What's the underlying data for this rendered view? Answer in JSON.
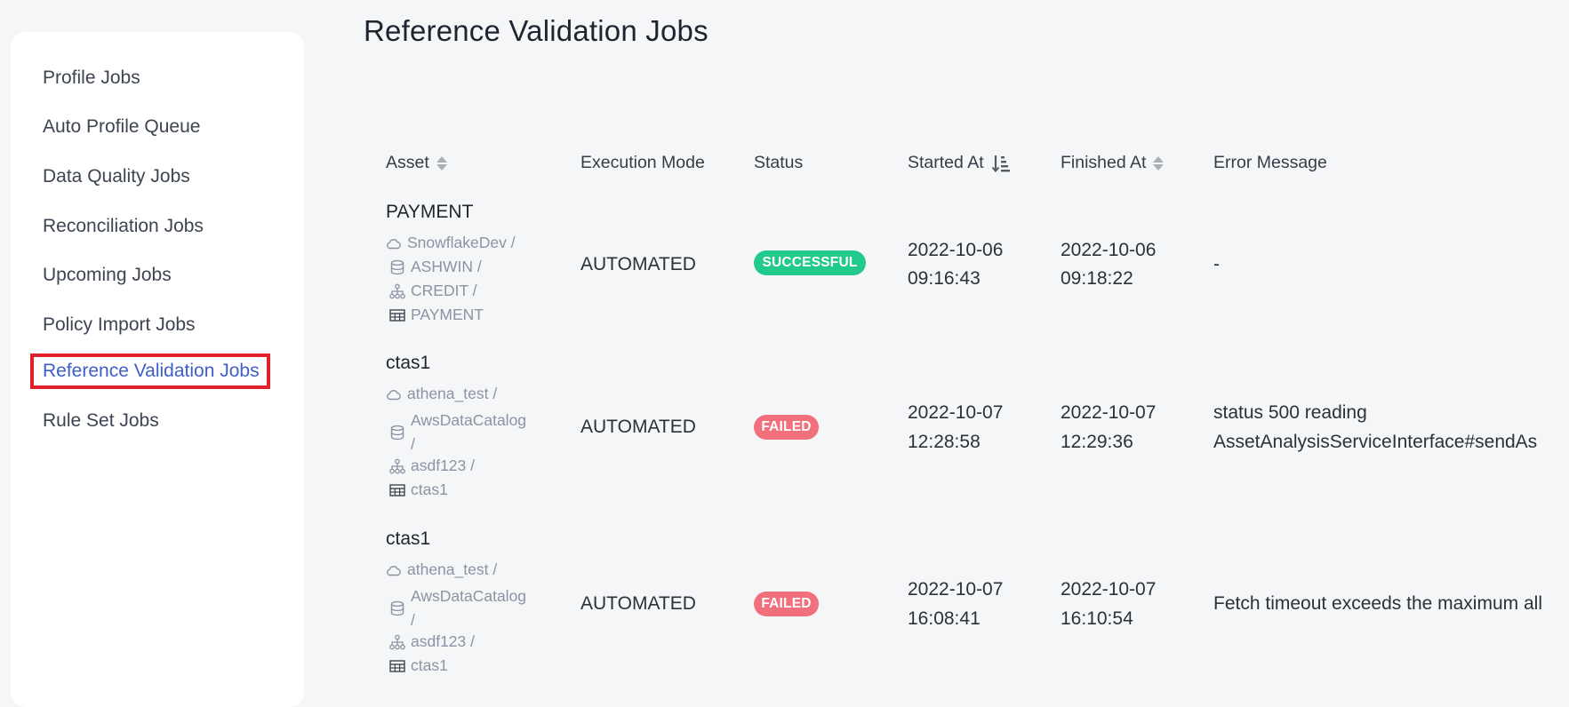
{
  "sidebar": {
    "items": [
      {
        "label": "Profile Jobs"
      },
      {
        "label": "Auto Profile Queue"
      },
      {
        "label": "Data Quality Jobs"
      },
      {
        "label": "Reconciliation Jobs"
      },
      {
        "label": "Upcoming Jobs"
      },
      {
        "label": "Policy Import Jobs"
      },
      {
        "label": "Reference Validation Jobs"
      },
      {
        "label": "Rule Set Jobs"
      }
    ],
    "active_index": 6
  },
  "page": {
    "title": "Reference Validation Jobs"
  },
  "table": {
    "headers": {
      "asset": "Asset",
      "execution_mode": "Execution Mode",
      "status": "Status",
      "started_at": "Started At",
      "finished_at": "Finished At",
      "error_message": "Error Message"
    },
    "rows": [
      {
        "asset_name": "PAYMENT",
        "path": {
          "datasource": "SnowflakeDev /",
          "database": "ASHWIN /",
          "schema": "CREDIT /",
          "table": "PAYMENT"
        },
        "execution_mode": "AUTOMATED",
        "status": "SUCCESSFUL",
        "started_date": "2022-10-06",
        "started_time": "09:16:43",
        "finished_date": "2022-10-06",
        "finished_time": "09:18:22",
        "error_line1": "-",
        "error_line2": ""
      },
      {
        "asset_name": "ctas1",
        "path": {
          "datasource": "athena_test /",
          "database": "AwsDataCatalog",
          "database_sep": "/",
          "schema": "asdf123 /",
          "table": "ctas1"
        },
        "execution_mode": "AUTOMATED",
        "status": "FAILED",
        "started_date": "2022-10-07",
        "started_time": "12:28:58",
        "finished_date": "2022-10-07",
        "finished_time": "12:29:36",
        "error_line1": "status 500 reading",
        "error_line2": "AssetAnalysisServiceInterface#sendAs"
      },
      {
        "asset_name": "ctas1",
        "path": {
          "datasource": "athena_test /",
          "database": "AwsDataCatalog",
          "database_sep": "/",
          "schema": "asdf123 /",
          "table": "ctas1"
        },
        "execution_mode": "AUTOMATED",
        "status": "FAILED",
        "started_date": "2022-10-07",
        "started_time": "16:08:41",
        "finished_date": "2022-10-07",
        "finished_time": "16:10:54",
        "error_line1": "Fetch timeout exceeds the maximum all",
        "error_line2": ""
      }
    ]
  },
  "colors": {
    "accent": "#3e5fc9",
    "success": "#21c98a",
    "failed": "#f2707c",
    "highlight": "#e0202a"
  },
  "icons": [
    "cloud-icon",
    "database-icon",
    "schema-icon",
    "table-icon",
    "sort-icon",
    "sort-descending-icon"
  ]
}
